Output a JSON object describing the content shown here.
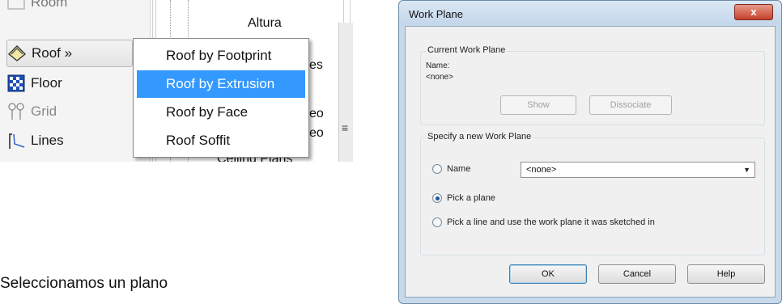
{
  "panel": {
    "room_label": "Room",
    "roof_label": "Roof »",
    "floor_label": "Floor",
    "grid_label": "Grid",
    "lines_label": "Lines"
  },
  "background_fragments": {
    "top": "Altura",
    "mid1": "es",
    "mid2": "eo",
    "mid3": "eo",
    "bottom": "Ceiling Plans"
  },
  "roof_menu": {
    "items": [
      "Roof by Footprint",
      "Roof by Extrusion",
      "Roof by Face",
      "Roof Soffit"
    ],
    "selected_index": 1
  },
  "caption": "Seleccionamos un plano",
  "dialog": {
    "title": "Work Plane",
    "close_glyph": "x",
    "current_group": {
      "legend": "Current Work Plane",
      "name_label": "Name:",
      "name_value": "<none>",
      "show_button": "Show",
      "dissociate_button": "Dissociate"
    },
    "specify_group": {
      "legend": "Specify a new Work Plane",
      "option_name": "Name",
      "name_select_value": "<none>",
      "option_pick_plane": "Pick a plane",
      "option_pick_line": "Pick a line and use the work plane it was sketched in",
      "selected_option": "Pick a plane"
    },
    "ok_button": "OK",
    "cancel_button": "Cancel",
    "help_button": "Help"
  },
  "colors": {
    "selection": "#3399ff",
    "close_button": "#c6412a",
    "dialog_frame": "#c8d9ea"
  }
}
